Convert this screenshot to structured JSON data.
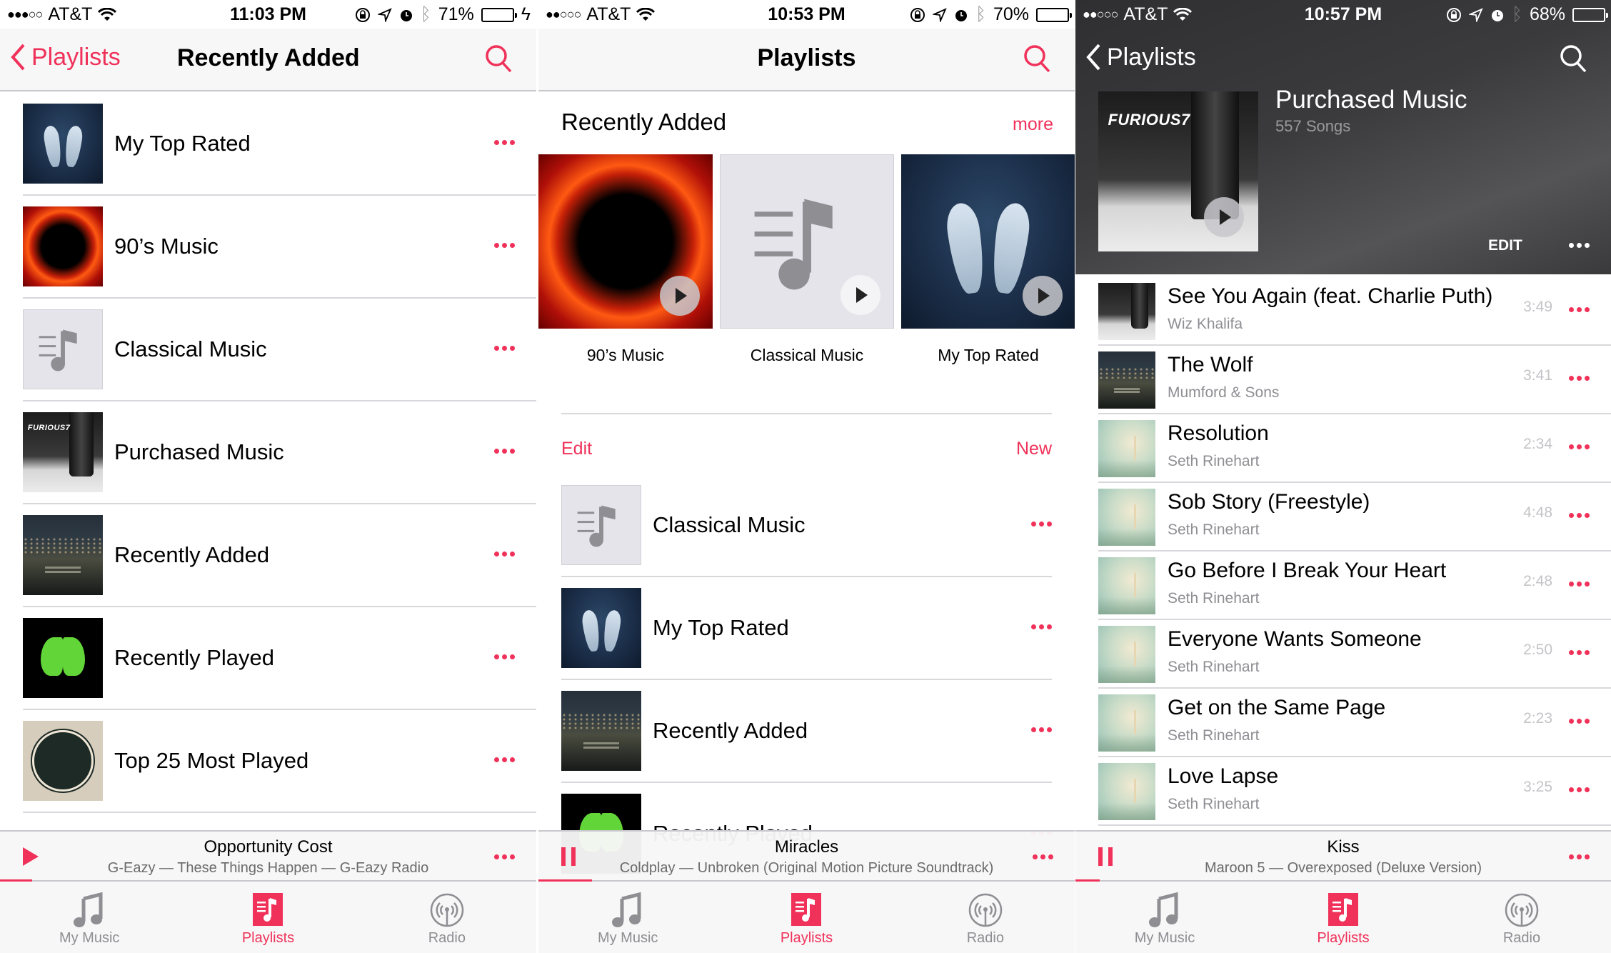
{
  "colors": {
    "accent": "#f0325a",
    "separator": "#d8d8dc",
    "secondary_text": "#8e8e93"
  },
  "panels": [
    {
      "status": {
        "signal": "●●●○○",
        "carrier": "AT&T",
        "time": "11:03 PM",
        "battery": "71%",
        "battery_level": 0.71,
        "charging": true
      },
      "nav": {
        "back_label": "Playlists",
        "title": "Recently Added"
      },
      "playlists": [
        {
          "name": "My Top Rated",
          "art": "coldplay"
        },
        {
          "name": "90’s Music",
          "art": "armageddon"
        },
        {
          "name": "Classical Music",
          "art": "placeholder"
        },
        {
          "name": "Purchased Music",
          "art": "furious"
        },
        {
          "name": "Recently Added",
          "art": "mumford"
        },
        {
          "name": "Recently Played",
          "art": "butterfly"
        },
        {
          "name": "Top 25 Most Played",
          "art": "avett"
        }
      ],
      "mini_player": {
        "state": "paused",
        "control_icon": "play-icon",
        "song": "Opportunity Cost",
        "subtitle": "G-Eazy — These Things Happen — G-Eazy Radio",
        "progress": 0.06
      },
      "tabs": [
        {
          "label": "My Music",
          "icon": "music-note-icon",
          "active": false
        },
        {
          "label": "Playlists",
          "icon": "playlist-icon",
          "active": true
        },
        {
          "label": "Radio",
          "icon": "radio-icon",
          "active": false
        }
      ]
    },
    {
      "status": {
        "signal": "●●○○○",
        "carrier": "AT&T",
        "time": "10:53 PM",
        "battery": "70%",
        "battery_level": 0.7
      },
      "nav": {
        "title": "Playlists"
      },
      "recently_added": {
        "heading": "Recently Added",
        "more_label": "more",
        "tiles": [
          {
            "label": "90’s Music",
            "art": "armageddon"
          },
          {
            "label": "Classical Music",
            "art": "placeholder"
          },
          {
            "label": "My Top Rated",
            "art": "coldplay"
          }
        ]
      },
      "edit_label": "Edit",
      "new_label": "New",
      "playlists": [
        {
          "name": "Classical Music",
          "art": "placeholder"
        },
        {
          "name": "My Top Rated",
          "art": "coldplay"
        },
        {
          "name": "Recently Added",
          "art": "mumford"
        },
        {
          "name": "Recently Played",
          "art": "butterfly"
        }
      ],
      "mini_player": {
        "state": "playing",
        "control_icon": "pause-icon",
        "song": "Miracles",
        "subtitle": "Coldplay — Unbroken (Original Motion Picture Soundtrack)",
        "progress": 0.1
      },
      "tabs": [
        {
          "label": "My Music",
          "icon": "music-note-icon",
          "active": false
        },
        {
          "label": "Playlists",
          "icon": "playlist-icon",
          "active": true
        },
        {
          "label": "Radio",
          "icon": "radio-icon",
          "active": false
        }
      ]
    },
    {
      "status": {
        "signal": "●●○○○",
        "carrier": "AT&T",
        "time": "10:57 PM",
        "battery": "68%",
        "battery_level": 0.68
      },
      "nav": {
        "back_label": "Playlists"
      },
      "playlist": {
        "title": "Purchased Music",
        "count": "557 Songs",
        "edit_label": "EDIT",
        "art": "furious"
      },
      "songs": [
        {
          "title": "See You Again (feat. Charlie Puth)",
          "artist": "Wiz Khalifa",
          "duration": "3:49",
          "art": "furious"
        },
        {
          "title": "The Wolf",
          "artist": "Mumford & Sons",
          "duration": "3:41",
          "art": "mumford"
        },
        {
          "title": "Resolution",
          "artist": "Seth Rinehart",
          "duration": "2:34",
          "art": "seth"
        },
        {
          "title": "Sob Story (Freestyle)",
          "artist": "Seth Rinehart",
          "duration": "4:48",
          "art": "seth"
        },
        {
          "title": "Go Before I Break Your Heart",
          "artist": "Seth Rinehart",
          "duration": "2:48",
          "art": "seth"
        },
        {
          "title": "Everyone Wants Someone",
          "artist": "Seth Rinehart",
          "duration": "2:50",
          "art": "seth"
        },
        {
          "title": "Get on the Same Page",
          "artist": "Seth Rinehart",
          "duration": "2:23",
          "art": "seth"
        },
        {
          "title": "Love Lapse",
          "artist": "Seth Rinehart",
          "duration": "3:25",
          "art": "seth"
        }
      ],
      "mini_player": {
        "state": "playing",
        "control_icon": "pause-icon",
        "song": "Kiss",
        "subtitle": "Maroon 5 — Overexposed (Deluxe Version)",
        "progress": 0.045
      },
      "tabs": [
        {
          "label": "My Music",
          "icon": "music-note-icon",
          "active": false
        },
        {
          "label": "Playlists",
          "icon": "playlist-icon",
          "active": true
        },
        {
          "label": "Radio",
          "icon": "radio-icon",
          "active": false
        }
      ]
    }
  ]
}
